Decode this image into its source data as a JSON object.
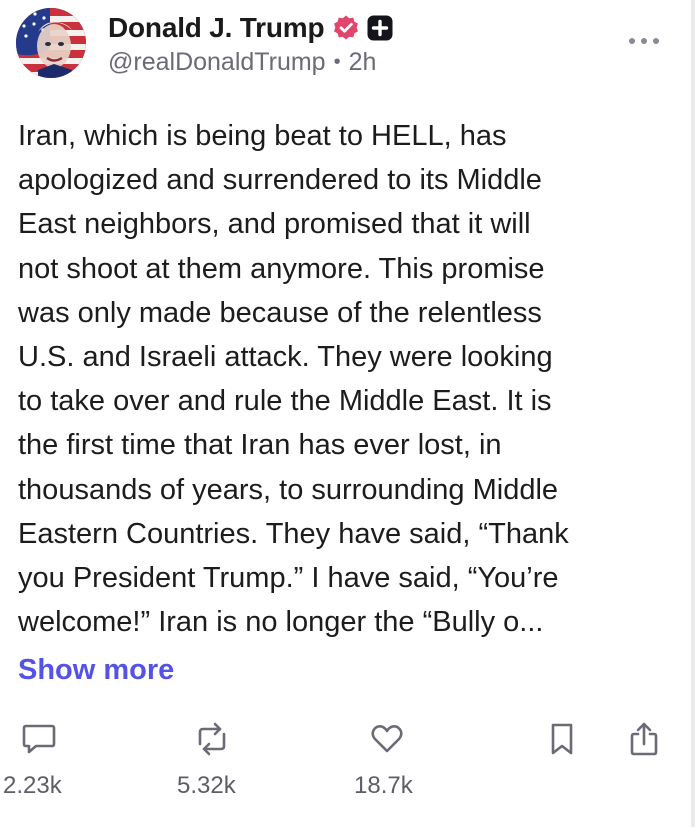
{
  "author": {
    "display_name": "Donald J. Trump",
    "handle": "@realDonaldTrump",
    "separator": "•",
    "time_ago": "2h",
    "badges": [
      "verified-badge-icon",
      "plus-badge-icon"
    ]
  },
  "post": {
    "lines": [
      "Iran, which is being beat to HELL, has",
      "apologized and surrendered to its Middle",
      "East neighbors, and promised that it will",
      "not shoot at them anymore. This promise",
      "was only made because of the relentless",
      "U.S. and Israeli attack. They were looking",
      "to take over and rule the Middle East. It is",
      "the first time that Iran has ever lost, in",
      "thousands of years, to surrounding Middle",
      "Eastern Countries. They have said, “Thank",
      "you President Trump.” I have said, “You’re",
      "welcome!” Iran is no longer the “Bully o..."
    ],
    "show_more_label": "Show more"
  },
  "actions": {
    "replies": {
      "icon": "comment-icon",
      "count": "2.23k"
    },
    "retruths": {
      "icon": "repost-icon",
      "count": "5.32k"
    },
    "likes": {
      "icon": "heart-icon",
      "count": "18.7k"
    },
    "bookmark": {
      "icon": "bookmark-icon"
    },
    "share": {
      "icon": "share-icon"
    }
  },
  "colors": {
    "link": "#5552e6",
    "verified": "#e0456b",
    "icon_gray": "#6b6b78",
    "text": "#1c1c1c"
  }
}
